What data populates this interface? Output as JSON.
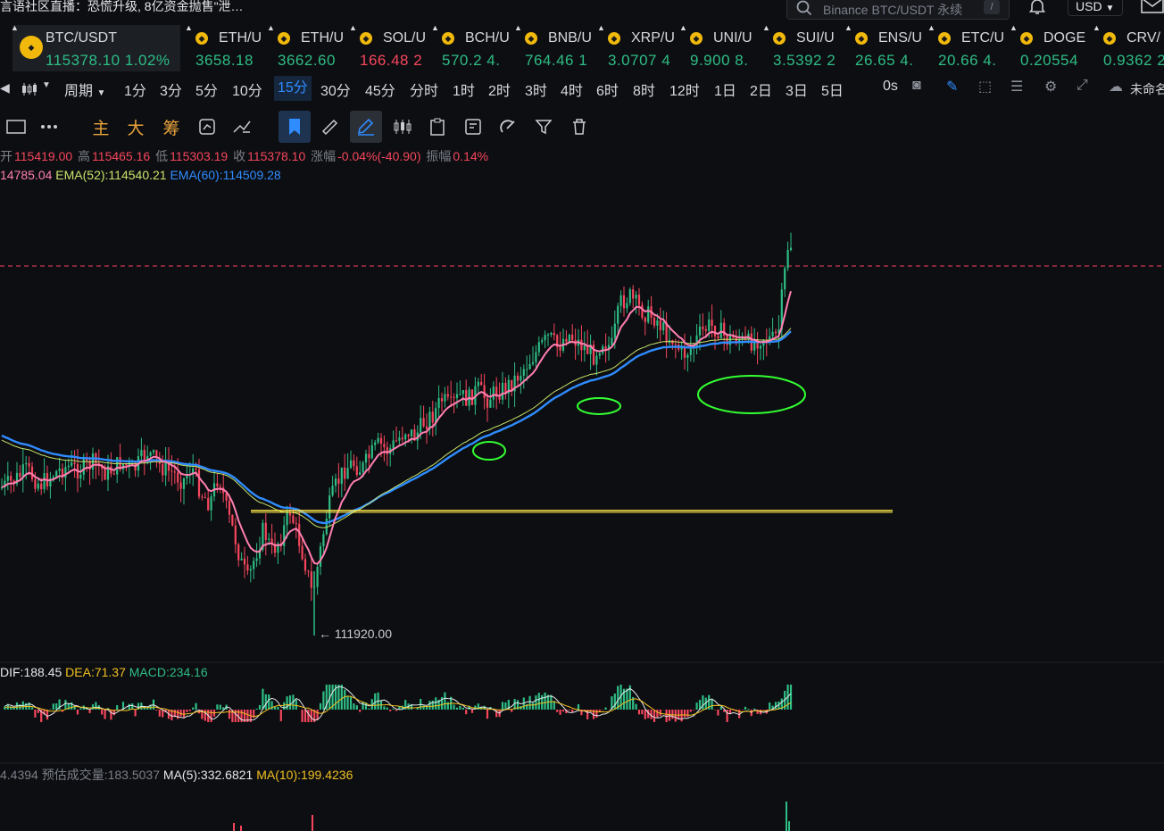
{
  "news_banner": "言语社区直播：恐慌升级, 8亿资金抛售\"泄…",
  "search": {
    "placeholder": "Binance BTC/USDT 永续",
    "shortcut": "/"
  },
  "currency": "USD",
  "tickers": [
    {
      "symbol": "BTC/USDT",
      "price": "115378.10",
      "change": "1.02%",
      "dir": "up",
      "active": true
    },
    {
      "symbol": "ETH/U",
      "price": "3658.18",
      "change": "",
      "dir": "up"
    },
    {
      "symbol": "ETH/U",
      "price": "3662.60",
      "change": "",
      "dir": "up"
    },
    {
      "symbol": "SOL/U",
      "price": "166.48",
      "change": "2",
      "dir": "dn"
    },
    {
      "symbol": "BCH/U",
      "price": "570.2",
      "change": "4.",
      "dir": "up"
    },
    {
      "symbol": "BNB/U",
      "price": "764.46",
      "change": "1",
      "dir": "up"
    },
    {
      "symbol": "XRP/U",
      "price": "3.0707",
      "change": "4",
      "dir": "up"
    },
    {
      "symbol": "UNI/U",
      "price": "9.900",
      "change": "8.",
      "dir": "up"
    },
    {
      "symbol": "SUI/U",
      "price": "3.5392",
      "change": "2",
      "dir": "up"
    },
    {
      "symbol": "ENS/U",
      "price": "26.65",
      "change": "4.",
      "dir": "up"
    },
    {
      "symbol": "ETC/U",
      "price": "20.66",
      "change": "4.",
      "dir": "up"
    },
    {
      "symbol": "DOGE",
      "price": "0.20554",
      "change": "",
      "dir": "up"
    },
    {
      "symbol": "CRV/",
      "price": "0.9362",
      "change": "2",
      "dir": "up"
    }
  ],
  "timeframes": {
    "chart_type_label": "",
    "period_label": "周期",
    "items": [
      "1分",
      "3分",
      "5分",
      "10分",
      "15分",
      "30分",
      "45分",
      "分时",
      "1时",
      "2时",
      "3时",
      "4时",
      "6时",
      "8时",
      "12时",
      "1日",
      "2日",
      "3日",
      "5日"
    ],
    "selected": "15分",
    "countdown": "0s",
    "unnamed_label": "未命名"
  },
  "toolbar": {
    "main": "主",
    "big": "大",
    "chip": "筹"
  },
  "ohlc": {
    "open_label": "开",
    "open": "115419.00",
    "high_label": "高",
    "high": "115465.16",
    "low_label": "低",
    "low": "115303.19",
    "close_label": "收",
    "close": "115378.10",
    "change_label": "涨幅",
    "change": "-0.04%(-40.90)",
    "amp_label": "振幅",
    "amp": "0.14%"
  },
  "ema": {
    "ema1": "14785.04",
    "ema52": "EMA(52):114540.21",
    "ema60": "EMA(60):114509.28"
  },
  "low_marker": "← 111920.00",
  "macd": {
    "dif": "DIF:188.45",
    "dea": "DEA:71.37",
    "macd": "MACD:234.16"
  },
  "volume": {
    "vol": "4.4394",
    "est": "预估成交量:183.5037",
    "ma5": "MA(5):332.6821",
    "ma10": "MA(10):199.4236"
  },
  "colors": {
    "up": "#2ebd85",
    "down": "#f6465d",
    "ema_fast": "#ff7fb2",
    "ema52": "#c7e36b",
    "ema60": "#2f8cff",
    "accent": "#2f8cff",
    "annotation_line": "#ffe94a",
    "annotation_circle": "#33ff33"
  },
  "chart_data": {
    "type": "candlestick",
    "interval": "15分",
    "price_range": [
      111920.0,
      115465.16
    ],
    "last_close": 115378.1,
    "recorded_low": 111920.0,
    "path": [
      [
        0,
        0.62
      ],
      [
        15,
        0.6
      ],
      [
        30,
        0.57
      ],
      [
        45,
        0.61
      ],
      [
        60,
        0.58
      ],
      [
        75,
        0.56
      ],
      [
        90,
        0.57
      ],
      [
        105,
        0.55
      ],
      [
        120,
        0.58
      ],
      [
        135,
        0.55
      ],
      [
        150,
        0.57
      ],
      [
        165,
        0.52
      ],
      [
        180,
        0.56
      ],
      [
        195,
        0.58
      ],
      [
        205,
        0.6
      ],
      [
        215,
        0.56
      ],
      [
        225,
        0.63
      ],
      [
        235,
        0.66
      ],
      [
        245,
        0.58
      ],
      [
        255,
        0.69
      ],
      [
        262,
        0.74
      ],
      [
        270,
        0.82
      ],
      [
        278,
        0.87
      ],
      [
        286,
        0.8
      ],
      [
        295,
        0.73
      ],
      [
        305,
        0.79
      ],
      [
        315,
        0.75
      ],
      [
        325,
        0.68
      ],
      [
        335,
        0.76
      ],
      [
        343,
        0.83
      ],
      [
        350,
        0.91
      ],
      [
        358,
        0.8
      ],
      [
        366,
        0.69
      ],
      [
        375,
        0.62
      ],
      [
        385,
        0.57
      ],
      [
        395,
        0.55
      ],
      [
        405,
        0.57
      ],
      [
        415,
        0.53
      ],
      [
        425,
        0.5
      ],
      [
        435,
        0.52
      ],
      [
        445,
        0.49
      ],
      [
        455,
        0.46
      ],
      [
        465,
        0.48
      ],
      [
        475,
        0.44
      ],
      [
        485,
        0.42
      ],
      [
        495,
        0.38
      ],
      [
        505,
        0.4
      ],
      [
        515,
        0.37
      ],
      [
        525,
        0.38
      ],
      [
        535,
        0.35
      ],
      [
        545,
        0.38
      ],
      [
        555,
        0.36
      ],
      [
        565,
        0.35
      ],
      [
        575,
        0.33
      ],
      [
        585,
        0.3
      ],
      [
        595,
        0.27
      ],
      [
        605,
        0.24
      ],
      [
        615,
        0.21
      ],
      [
        625,
        0.24
      ],
      [
        635,
        0.2
      ],
      [
        645,
        0.22
      ],
      [
        655,
        0.24
      ],
      [
        665,
        0.26
      ],
      [
        675,
        0.22
      ],
      [
        685,
        0.24
      ],
      [
        695,
        0.12
      ],
      [
        705,
        0.1
      ],
      [
        715,
        0.13
      ],
      [
        725,
        0.15
      ],
      [
        735,
        0.16
      ],
      [
        745,
        0.2
      ],
      [
        755,
        0.22
      ],
      [
        765,
        0.26
      ],
      [
        775,
        0.24
      ],
      [
        785,
        0.2
      ],
      [
        795,
        0.18
      ],
      [
        805,
        0.19
      ],
      [
        815,
        0.22
      ],
      [
        825,
        0.21
      ],
      [
        835,
        0.23
      ],
      [
        845,
        0.22
      ],
      [
        855,
        0.21
      ],
      [
        865,
        0.22
      ],
      [
        872,
        0.2
      ],
      [
        877,
        0.08
      ],
      [
        881,
        -0.02
      ],
      [
        885,
        -0.03
      ]
    ]
  }
}
